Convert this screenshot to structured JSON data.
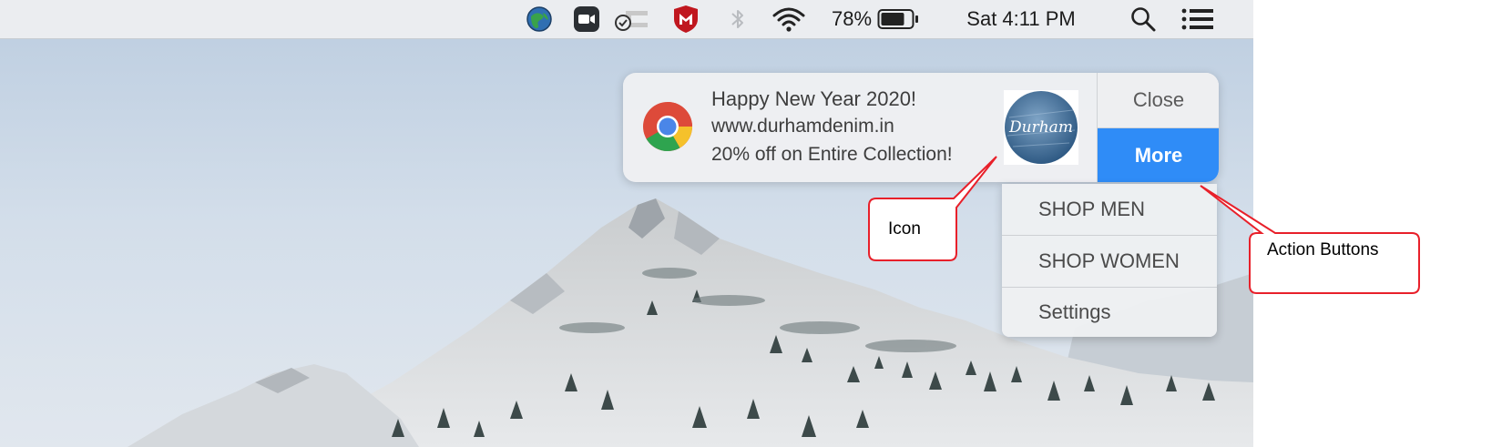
{
  "menubar": {
    "icons": [
      "globe-icon",
      "zoom-icon",
      "link-icon",
      "mcafee-icon",
      "bluetooth-icon",
      "wifi-icon"
    ],
    "battery_percent": "78%",
    "battery_level": 0.78,
    "clock": "Sat 4:11 PM",
    "right_icons": [
      "spotlight-search-icon",
      "notification-center-icon"
    ]
  },
  "notification": {
    "app_icon": "chrome-icon",
    "title": "Happy New Year 2020!",
    "subtitle": "www.durhamdenim.in",
    "body": "20% off on Entire Collection!",
    "content_icon": {
      "name": "durham-logo-icon",
      "logo_text": "Durham",
      "colors": {
        "denim": "#3d6a95",
        "denim_light": "#7fa4c6"
      }
    },
    "close_label": "Close",
    "more_label": "More",
    "accent": "#2f8cf7"
  },
  "dropdown": {
    "items": [
      {
        "label": "SHOP MEN"
      },
      {
        "label": "SHOP WOMEN"
      },
      {
        "label": "Settings"
      }
    ]
  },
  "annotations": {
    "icon_label": "Icon",
    "actions_label": "Action Buttons",
    "callout_color": "#e8202a"
  }
}
